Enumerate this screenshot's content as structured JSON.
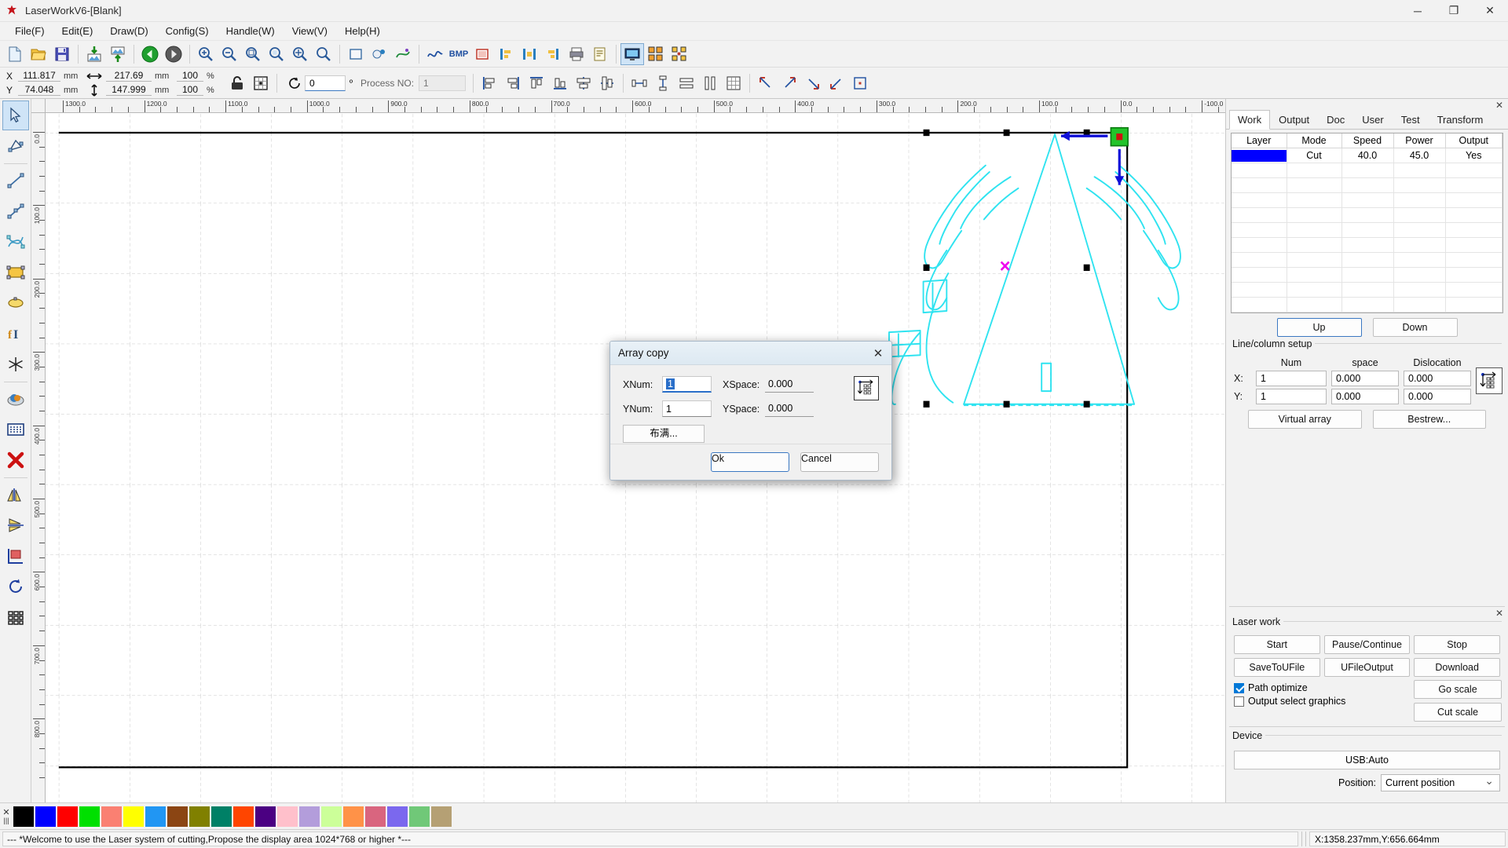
{
  "window": {
    "title": "LaserWorkV6-[Blank]",
    "minimize": "─",
    "maximize": "❐",
    "close": "✕"
  },
  "menu": {
    "items": [
      {
        "label": "File(F)",
        "name": "menu-file"
      },
      {
        "label": "Edit(E)",
        "name": "menu-edit"
      },
      {
        "label": "Draw(D)",
        "name": "menu-draw"
      },
      {
        "label": "Config(S)",
        "name": "menu-config"
      },
      {
        "label": "Handle(W)",
        "name": "menu-handle"
      },
      {
        "label": "View(V)",
        "name": "menu-view"
      },
      {
        "label": "Help(H)",
        "name": "menu-help"
      }
    ]
  },
  "coordbar": {
    "x_label": "X",
    "y_label": "Y",
    "x_value": "111.817",
    "y_value": "74.048",
    "width_value": "217.69",
    "height_value": "147.999",
    "x_scale": "100",
    "y_scale": "100",
    "mm": "mm",
    "percent": "%",
    "rotation": "0",
    "rotation_unit": "º",
    "process_label": "Process NO:",
    "process_value": "1"
  },
  "rulers": {
    "h_labels": [
      "1300.0",
      "1200.0",
      "1100.0",
      "1000.0",
      "900.0",
      "800.0",
      "700.0",
      "600.0",
      "500.0",
      "400.0",
      "300.0",
      "200.0",
      "100.0",
      "0.0",
      "-100.0"
    ],
    "v_labels": [
      "0.0",
      "100.0",
      "200.0",
      "300.0",
      "400.0",
      "500.0",
      "600.0",
      "700.0",
      "800.0"
    ]
  },
  "right_panel": {
    "close_glyph": "✕",
    "tabs": [
      {
        "label": "Work",
        "active": true
      },
      {
        "label": "Output",
        "active": false
      },
      {
        "label": "Doc",
        "active": false
      },
      {
        "label": "User",
        "active": false
      },
      {
        "label": "Test",
        "active": false
      },
      {
        "label": "Transform",
        "active": false
      }
    ],
    "layer_table": {
      "headers": [
        "Layer",
        "Mode",
        "Speed",
        "Power",
        "Output"
      ],
      "rows": [
        {
          "color": "#0000ff",
          "mode": "Cut",
          "speed": "40.0",
          "power": "45.0",
          "output": "Yes"
        }
      ],
      "empty_rows": 10
    },
    "up_label": "Up",
    "down_label": "Down",
    "linecolumn": {
      "title": "Line/column setup",
      "headers": {
        "num": "Num",
        "space": "space",
        "dislocation": "Dislocation"
      },
      "x_label": "X:",
      "y_label": "Y:",
      "x_num": "1",
      "x_space": "0.000",
      "x_disloc": "0.000",
      "y_num": "1",
      "y_space": "0.000",
      "y_disloc": "0.000",
      "virtual_array": "Virtual array",
      "bestrew": "Bestrew..."
    },
    "laser_work": {
      "title": "Laser work",
      "start": "Start",
      "pause": "Pause/Continue",
      "stop": "Stop",
      "save_to_ufile": "SaveToUFile",
      "ufile_output": "UFileOutput",
      "download": "Download",
      "path_optimize": "Path optimize",
      "path_optimize_checked": true,
      "output_select_graphics": "Output select graphics",
      "output_select_checked": false,
      "go_scale": "Go scale",
      "cut_scale": "Cut scale"
    },
    "device": {
      "title": "Device",
      "value": "USB:Auto",
      "position_label": "Position:",
      "position_value": "Current position"
    }
  },
  "dialog": {
    "title": "Array copy",
    "close_glyph": "✕",
    "xnum_label": "XNum:",
    "xnum_value": "1",
    "ynum_label": "YNum:",
    "ynum_value": "1",
    "xspace_label": "XSpace:",
    "xspace_value": "0.000",
    "yspace_label": "YSpace:",
    "yspace_value": "0.000",
    "fill_label": "布满...",
    "ok_label": "Ok",
    "cancel_label": "Cancel"
  },
  "palette": {
    "close_glyph": "✕",
    "colors": [
      "#000000",
      "#0000ff",
      "#ff0000",
      "#00e000",
      "#fa8072",
      "#ffff00",
      "#2196f3",
      "#8b4513",
      "#808000",
      "#008066",
      "#ff4500",
      "#4b0082",
      "#ffc0cb",
      "#b39ddb",
      "#ccff99",
      "#ff9248",
      "#d9657f",
      "#7b68ee",
      "#70c878",
      "#b5a074"
    ]
  },
  "statusbar": {
    "message": "--- *Welcome to use the Laser system of cutting,Propose the display area 1024*768 or higher *---",
    "coords": "X:1358.237mm,Y:656.664mm"
  },
  "left_tools": [
    {
      "name": "select-tool",
      "glyph": "select",
      "selected": true
    },
    {
      "name": "node-edit-tool",
      "glyph": "node",
      "selected": false
    },
    {
      "name": "line-tool",
      "glyph": "line",
      "selected": false
    },
    {
      "name": "polyline-tool",
      "glyph": "polyline",
      "selected": false
    },
    {
      "name": "bezier-tool",
      "glyph": "bezier",
      "selected": false
    },
    {
      "name": "rectangle-tool",
      "glyph": "rect",
      "selected": false
    },
    {
      "name": "ellipse-tool",
      "glyph": "ellipse",
      "selected": false
    },
    {
      "name": "text-tool",
      "glyph": "text",
      "selected": false
    },
    {
      "name": "capture-tool",
      "glyph": "star",
      "selected": false
    },
    {
      "name": "platform-tool",
      "glyph": "platform",
      "selected": false
    },
    {
      "name": "dot-array-tool",
      "glyph": "dotarray",
      "selected": false
    },
    {
      "name": "delete-tool",
      "glyph": "delete",
      "selected": false
    },
    {
      "name": "mirror-horizontal-tool",
      "glyph": "mirrorh",
      "selected": false
    },
    {
      "name": "mirror-vertical-tool",
      "glyph": "mirrorv",
      "selected": false
    },
    {
      "name": "align-tool",
      "glyph": "align",
      "selected": false
    },
    {
      "name": "rotate-tool",
      "glyph": "rotate",
      "selected": false
    },
    {
      "name": "array-tool",
      "glyph": "array",
      "selected": false
    }
  ],
  "canvas": {
    "selection_center_marker": "×",
    "shape_color": "#33e0ee"
  }
}
